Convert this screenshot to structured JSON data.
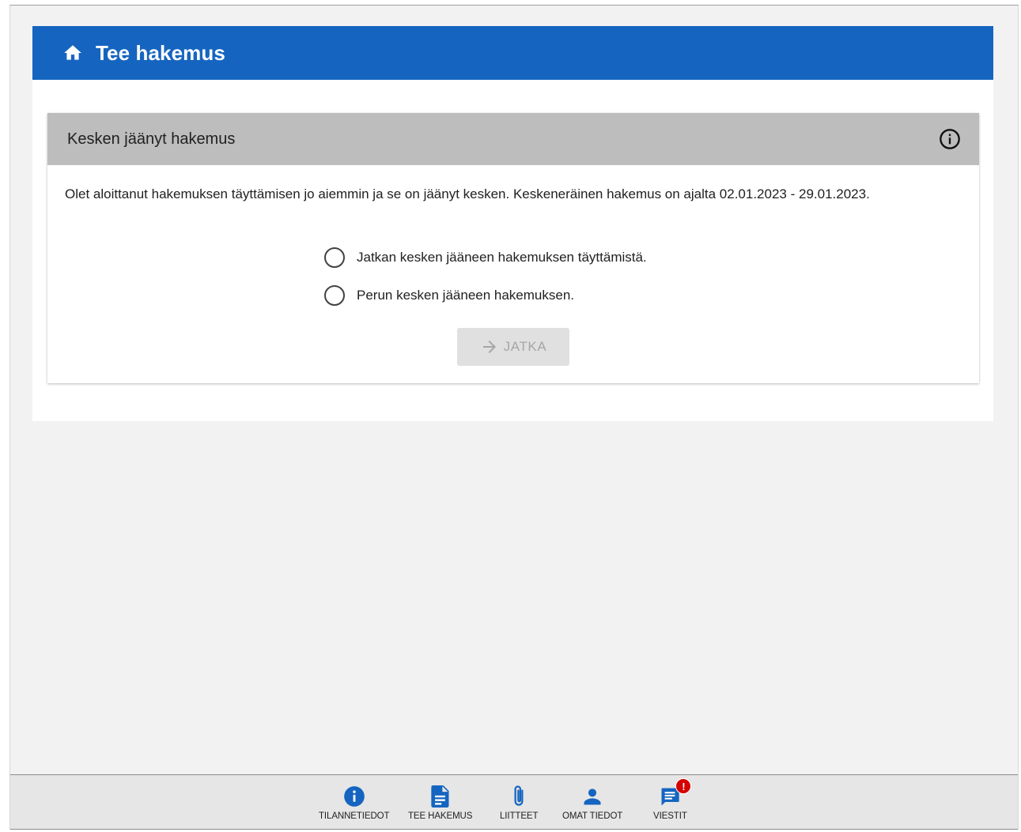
{
  "header": {
    "title": "Tee hakemus"
  },
  "notice": {
    "title": "Kesken jäänyt hakemus",
    "body": "Olet aloittanut hakemuksen täyttämisen jo aiemmin ja se on jäänyt kesken. Keskeneräinen hakemus on ajalta 02.01.2023 - 29.01.2023.",
    "options": [
      {
        "label": "Jatkan kesken jääneen hakemuksen täyttämistä.",
        "selected": false
      },
      {
        "label": "Perun kesken jääneen hakemuksen.",
        "selected": false
      }
    ],
    "continue_label": "JATKA",
    "continue_enabled": false
  },
  "bottom_nav": {
    "items": [
      {
        "label": "TILANNETIEDOT",
        "icon": "info-icon"
      },
      {
        "label": "TEE HAKEMUS",
        "icon": "document-icon"
      },
      {
        "label": "LIITTEET",
        "icon": "paperclip-icon"
      },
      {
        "label": "OMAT TIEDOT",
        "icon": "person-icon"
      },
      {
        "label": "VIESTIT",
        "icon": "message-icon"
      }
    ],
    "messages_badge": "!"
  },
  "colors": {
    "primary": "#1565c0",
    "notice_header_bg": "#bdbdbd",
    "disabled_button_bg": "#e0e0e0",
    "badge": "#d50000"
  }
}
